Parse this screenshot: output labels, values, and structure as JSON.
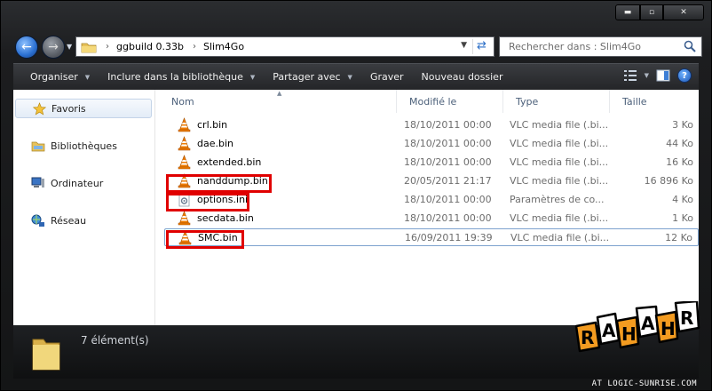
{
  "window": {
    "caption": {
      "minimize": "▬",
      "maximize": "▫",
      "close": "✕"
    }
  },
  "nav": {
    "back_icon": "back-arrow-icon",
    "forward_icon": "forward-arrow-icon",
    "breadcrumb": [
      "ggbuild 0.33b",
      "Slim4Go"
    ],
    "search_placeholder": "Rechercher dans : Slim4Go"
  },
  "toolbar": {
    "organize": "Organiser",
    "include_library": "Inclure dans la bibliothèque",
    "share_with": "Partager avec",
    "burn": "Graver",
    "new_folder": "Nouveau dossier"
  },
  "sidebar": {
    "items": [
      {
        "label": "Favoris",
        "icon": "star-icon",
        "selected": true
      },
      {
        "label": "Bibliothèques",
        "icon": "libraries-icon",
        "selected": false
      },
      {
        "label": "Ordinateur",
        "icon": "computer-icon",
        "selected": false
      },
      {
        "label": "Réseau",
        "icon": "network-icon",
        "selected": false
      }
    ]
  },
  "columns": {
    "name": "Nom",
    "modified": "Modifié le",
    "type": "Type",
    "size": "Taille"
  },
  "files": [
    {
      "name": "crl.bin",
      "modified": "18/10/2011 00:00",
      "type": "VLC media file (.bi...",
      "size": "3 Ko",
      "icon": "vlc-cone-icon"
    },
    {
      "name": "dae.bin",
      "modified": "18/10/2011 00:00",
      "type": "VLC media file (.bi...",
      "size": "44 Ko",
      "icon": "vlc-cone-icon"
    },
    {
      "name": "extended.bin",
      "modified": "18/10/2011 00:00",
      "type": "VLC media file (.bi...",
      "size": "16 Ko",
      "icon": "vlc-cone-icon"
    },
    {
      "name": "nanddump.bin",
      "modified": "20/05/2011 21:17",
      "type": "VLC media file (.bi...",
      "size": "16 896 Ko",
      "icon": "vlc-cone-icon"
    },
    {
      "name": "options.ini",
      "modified": "18/10/2011 00:00",
      "type": "Paramètres de co...",
      "size": "4 Ko",
      "icon": "settings-file-icon"
    },
    {
      "name": "secdata.bin",
      "modified": "18/10/2011 00:00",
      "type": "VLC media file (.bi...",
      "size": "1 Ko",
      "icon": "vlc-cone-icon"
    },
    {
      "name": "SMC.bin",
      "modified": "16/09/2011 19:39",
      "type": "VLC media file (.bi...",
      "size": "12 Ko",
      "icon": "vlc-cone-icon"
    }
  ],
  "status": {
    "count": "7 élément(s)"
  },
  "watermark": {
    "logo": "RAHAHR",
    "credit": "AT LOGIC-SUNRISE.COM"
  },
  "colors": {
    "highlight": "#e00000",
    "vlc_orange": "#f07d00",
    "chrome_dark": "#1c1d1f"
  }
}
